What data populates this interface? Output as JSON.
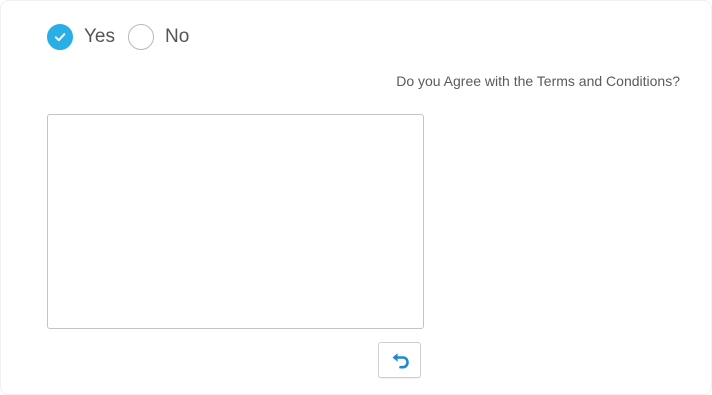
{
  "colors": {
    "accent": "#29aee6",
    "text": "#555555",
    "border": "#c4c4c4"
  },
  "agreement": {
    "options": [
      {
        "label": "Yes",
        "checked": true
      },
      {
        "label": "No",
        "checked": false
      }
    ],
    "question": "Do you Agree with the Terms and Conditions?"
  },
  "signature": {
    "undo_icon": "undo-icon"
  }
}
